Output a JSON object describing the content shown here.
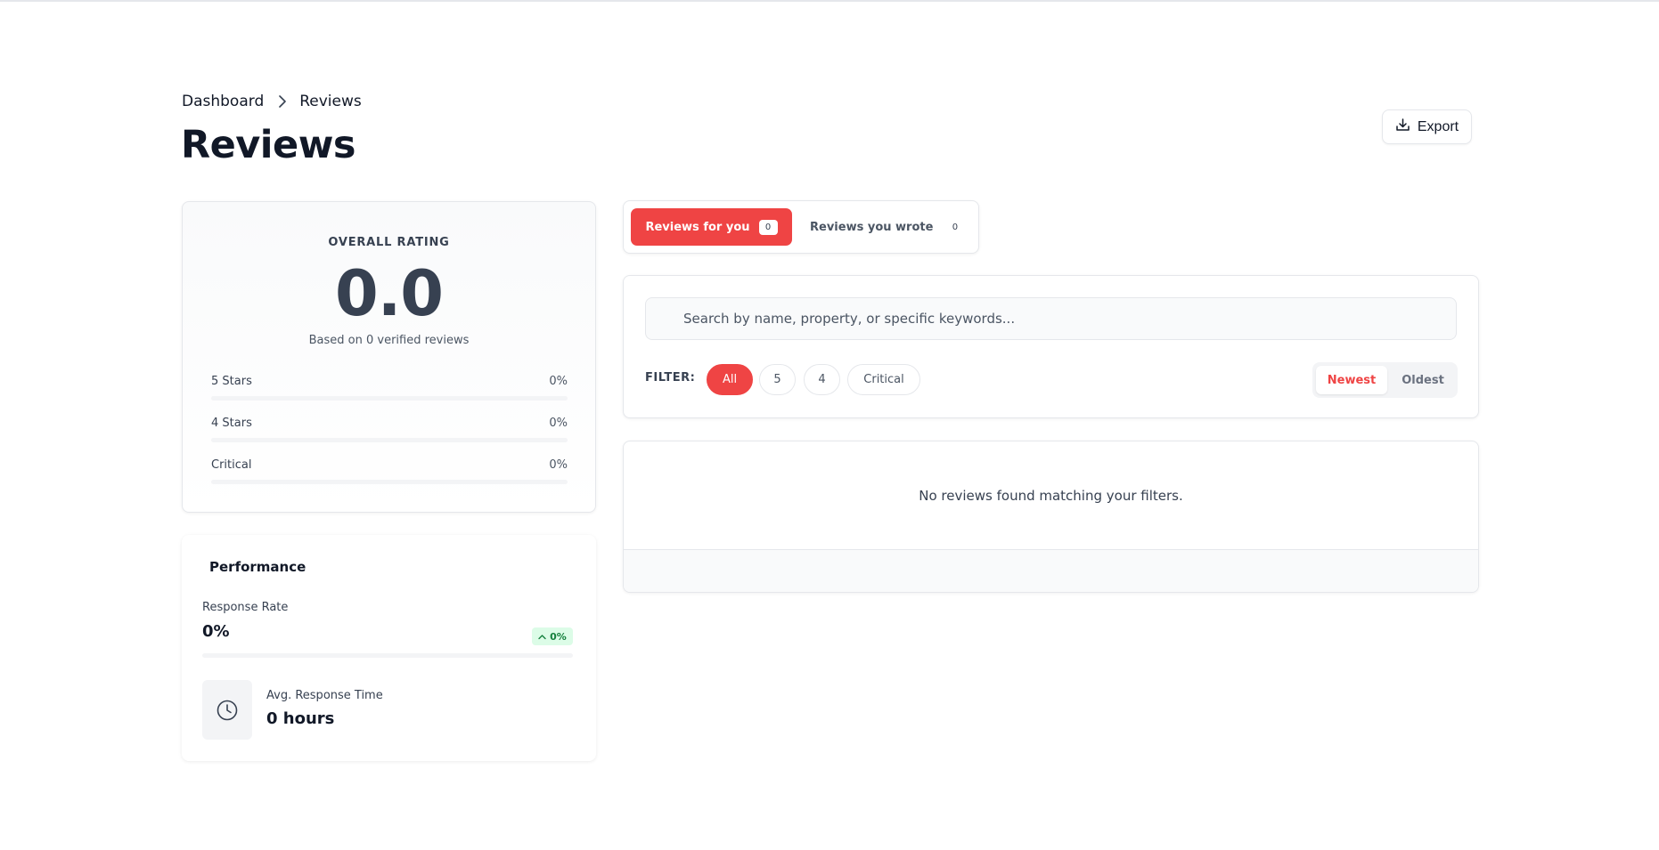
{
  "breadcrumb": {
    "items": [
      "Dashboard",
      "Reviews"
    ]
  },
  "page": {
    "title": "Reviews",
    "export_label": "Export"
  },
  "rating": {
    "label": "OVERALL RATING",
    "value": "0.0",
    "based_on": "Based on 0 verified reviews",
    "distribution": [
      {
        "label": "5 Stars",
        "percent_text": "0%",
        "percent": 0
      },
      {
        "label": "4 Stars",
        "percent_text": "0%",
        "percent": 0
      },
      {
        "label": "Critical",
        "percent_text": "0%",
        "percent": 0
      }
    ]
  },
  "performance": {
    "title": "Performance",
    "response_rate_label": "Response Rate",
    "response_rate_value": "0%",
    "response_rate_percent": 0,
    "trend": "0%",
    "avg_response_label": "Avg. Response Time",
    "avg_response_value": "0 hours"
  },
  "tabs": [
    {
      "label": "Reviews for you",
      "count": "0",
      "active": true
    },
    {
      "label": "Reviews you wrote",
      "count": "0",
      "active": false
    }
  ],
  "search": {
    "placeholder": "Search by name, property, or specific keywords...",
    "value": ""
  },
  "filter": {
    "label": "FILTER:",
    "chips": [
      {
        "label": "All",
        "active": true
      },
      {
        "label": "5",
        "active": false
      },
      {
        "label": "4",
        "active": false
      },
      {
        "label": "Critical",
        "active": false
      }
    ]
  },
  "sort": {
    "options": [
      "Newest",
      "Oldest"
    ],
    "selected": "Newest"
  },
  "results": {
    "empty_message": "No reviews found matching your filters."
  },
  "colors": {
    "accent": "#ef4444",
    "success": "#22c55e",
    "success_bg": "#dcfce7"
  },
  "icons": [
    "chevron-right-icon",
    "download-icon",
    "clock-icon",
    "arrow-up-icon"
  ]
}
